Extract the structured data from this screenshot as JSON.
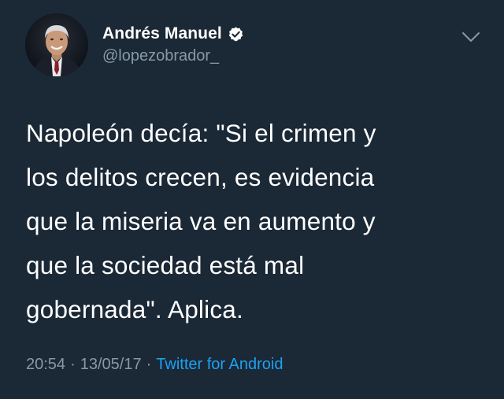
{
  "author": {
    "display_name": "Andrés Manuel",
    "handle": "@lopezobrador_",
    "avatar_icon": "profile-photo",
    "verified_icon": "verified-badge-icon"
  },
  "menu_icon": "chevron-down-icon",
  "tweet": {
    "text": "Napoleón decía: \"Si el crimen y\nlos delitos crecen, es evidencia\nque la miseria va en aumento y\nque la sociedad está mal\ngobernada\". Aplica.",
    "time": "20:54",
    "date": "13/05/17",
    "separator": "·",
    "source": "Twitter for Android"
  },
  "colors": {
    "background": "#1b2836",
    "name": "#ffffff",
    "secondary": "#8899a6",
    "link": "#1da1f2"
  }
}
